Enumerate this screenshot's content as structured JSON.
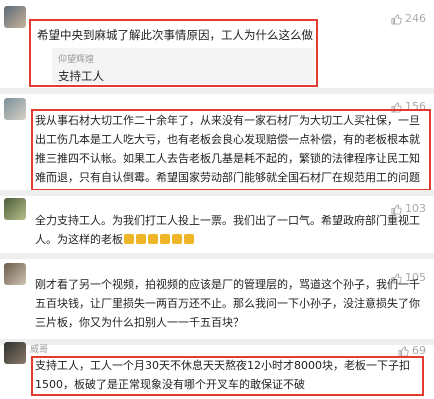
{
  "comments": [
    {
      "username": "",
      "likes": "246",
      "text": "希望中央到麻城了解此次事情原因，工人为什么这么做",
      "reply": {
        "username": "仰望辉煌",
        "text": "支持工人"
      }
    },
    {
      "username": "",
      "likes": "156",
      "text": "我从事石材大切工作二十余年了，从来没有一家石材厂为大切工人买社保，一旦出工伤几本是工人吃大亏，也有老板会良心发现赔偿一点补偿，有的老板根本就推三推四不认帐。如果工人去告老板几基是耗不起的，繁锁的法律程序让民工知难而退，只有自认倒霉。希望国家劳动部门能够就全国石材厂在规范用工的问题上加大执法力度。"
    },
    {
      "username": "",
      "likes": "103",
      "text": "全力支持工人。为我们打工人投上一票。我们出了一口气。希望政府部门重视工人。为这样的老板"
    },
    {
      "username": "",
      "likes": "105",
      "text": "刚才看了另一个视频，拍视频的应该是厂的管理层的，骂道这个孙子，我们一千五百块钱，让厂里损失一两百万还不止。那么我问一下小孙子，没注意损失了你三片板，你又为什么扣别人一一千五百块？"
    },
    {
      "username": "威哥",
      "likes": "69",
      "text": "支持工人，工人一个月30天不休息天天熬夜12小时才8000块，老板一下子扣1500，板破了是正常现象没有哪个开叉车的敢保证不破"
    }
  ],
  "colors": {
    "highlight": "#e23b2f",
    "emoji": "#f0b429"
  }
}
